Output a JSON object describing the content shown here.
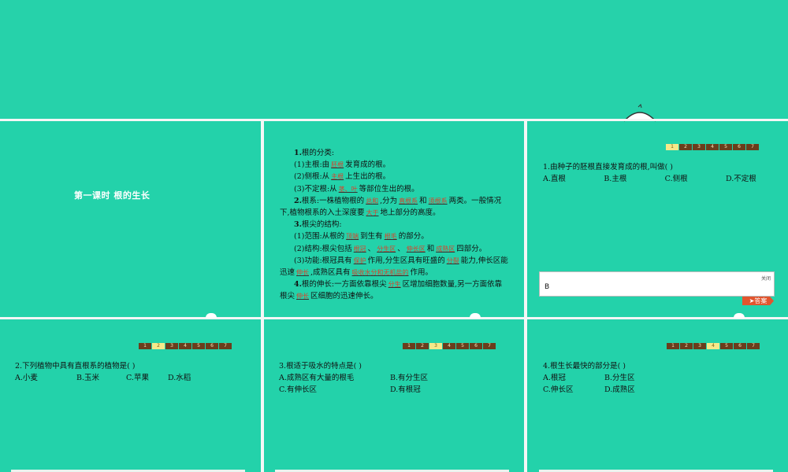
{
  "slide1": {
    "title": "第一课时    根的生长"
  },
  "notes": {
    "lines": [
      {
        "parts": [
          {
            "b": "1."
          },
          {
            "t": "根的分类:"
          }
        ],
        "ind": true
      },
      {
        "parts": [
          {
            "t": "(1)主根:由"
          },
          {
            "f": "胚根"
          },
          {
            "t": "发育成的根。"
          }
        ],
        "ind": true
      },
      {
        "parts": [
          {
            "t": "(2)侧根:从"
          },
          {
            "f": "主根"
          },
          {
            "t": "上生出的根。"
          }
        ],
        "ind": true
      },
      {
        "parts": [
          {
            "t": "(3)不定根:从"
          },
          {
            "f": "茎、叶"
          },
          {
            "t": "等部位生出的根。"
          }
        ],
        "ind": true
      },
      {
        "parts": [
          {
            "b": "2."
          },
          {
            "t": "根系:一株植物根的"
          },
          {
            "f": "总和"
          },
          {
            "t": ",分为"
          },
          {
            "f": "直根系"
          },
          {
            "t": "和"
          },
          {
            "f": "须根系"
          },
          {
            "t": "两类。一般情况下,植物根系的入土深度要"
          },
          {
            "f": "大于"
          },
          {
            "t": "地上部分的高度。"
          }
        ],
        "ind": true
      },
      {
        "parts": [
          {
            "b": "3."
          },
          {
            "t": "根尖的结构:"
          }
        ],
        "ind": true
      },
      {
        "parts": [
          {
            "t": "(1)范围:从根的"
          },
          {
            "f": "顶端"
          },
          {
            "t": "到生有"
          },
          {
            "f": "根毛"
          },
          {
            "t": "的部分。"
          }
        ],
        "ind": true
      },
      {
        "parts": [
          {
            "t": "(2)结构:根尖包括"
          },
          {
            "f": "根冠"
          },
          {
            "t": "、"
          },
          {
            "f": "分生区"
          },
          {
            "t": "、"
          },
          {
            "f": "伸长区"
          },
          {
            "t": "和"
          },
          {
            "f": "成熟区"
          },
          {
            "t": "四部分。"
          }
        ],
        "ind": true
      },
      {
        "parts": [
          {
            "t": "(3)功能:根冠具有"
          },
          {
            "f": "保护"
          },
          {
            "t": "作用,分生区具有旺盛的"
          },
          {
            "f": "分裂"
          },
          {
            "t": "能力,伸长区能迅速"
          },
          {
            "f": "伸长"
          },
          {
            "t": ",成熟区具有"
          },
          {
            "f": "吸收水分和无机盐的"
          },
          {
            "t": "作用。"
          }
        ],
        "ind": true
      },
      {
        "parts": [
          {
            "b": "4."
          },
          {
            "t": "根的伸长:一方面依靠根尖"
          },
          {
            "f": "分生"
          },
          {
            "t": "区增加细胞数量,另一方面依靠根尖"
          },
          {
            "f": "伸长"
          },
          {
            "t": "区细胞的迅速伸长。"
          }
        ],
        "ind": true
      }
    ]
  },
  "nav_numbers": [
    "1",
    "2",
    "3",
    "4",
    "5",
    "6",
    "7"
  ],
  "q1": {
    "stem": "1.由种子的胚根直接发育成的根,叫做(        )",
    "options": [
      "A.直根",
      "B.主根",
      "C.侧根",
      "D.不定根"
    ],
    "active": 0
  },
  "answer_box": {
    "close_label": "关闭",
    "value": "B",
    "button_label": "答案"
  },
  "q2": {
    "stem": "2.下列植物中具有直根系的植物是(        )",
    "options": [
      "A.小麦",
      "B.玉米",
      "C.苹果",
      "D.水稻"
    ],
    "active": 1
  },
  "q3": {
    "stem": "3.根适于吸水的特点是(        )",
    "options": [
      "A.成熟区有大量的根毛",
      "B.有分生区",
      "C.有伸长区",
      "D.有根冠"
    ],
    "active": 2
  },
  "q4": {
    "stem": "4.根生长最快的部分是(        )",
    "options": [
      "A.根冠",
      "B.分生区",
      "C.伸长区",
      "D.成熟区"
    ],
    "active": 3
  }
}
